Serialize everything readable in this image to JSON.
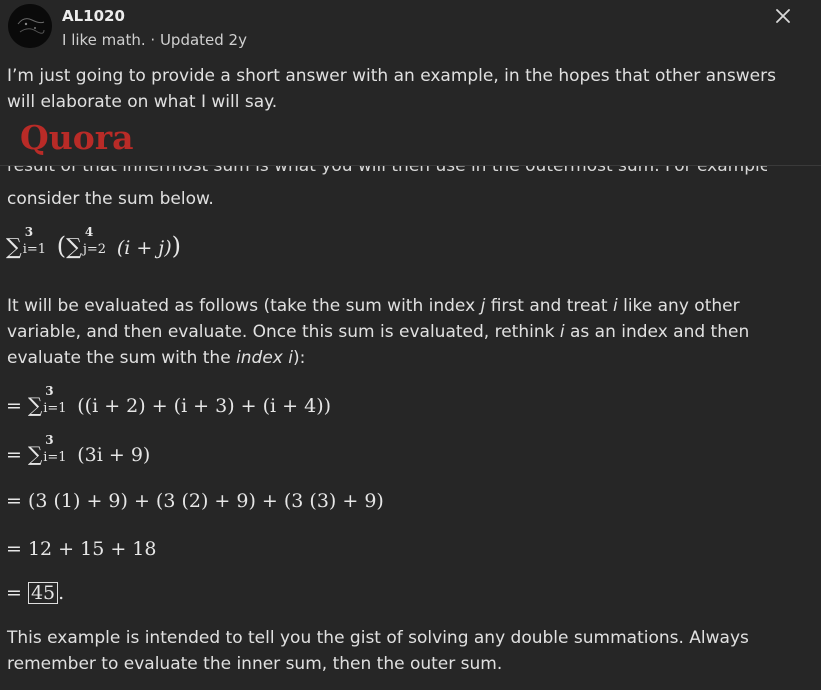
{
  "header": {
    "author": "AL1020",
    "meta": "I like math. · Updated 2y",
    "close_icon": "close-icon"
  },
  "intro": "I’m just going to provide a short answer with an example, in the hopes that other answers will elaborate on what I will say.",
  "banner": {
    "logo": "Quora"
  },
  "clipped_line": "result of that innermost sum is what you will then use in the outermost sum. For example,",
  "consider": "consider the sum below.",
  "main_expr": {
    "outer_upper": "3",
    "outer_lower": "i=1",
    "inner_upper": "4",
    "inner_lower": "j=2",
    "body": "(i + j)"
  },
  "explanation": {
    "part1": "It will be evaluated as follows (take the sum with index ",
    "var_j": "j",
    "part2": " first and treat ",
    "var_i1": "i",
    "part3": " like any other variable, and then evaluate. Once this sum is evaluated, rethink ",
    "var_i2": "i",
    "part4": " as an index and then evaluate the sum with the ",
    "index_word": "index",
    "space": " ",
    "var_i3": "i",
    "part5": "):"
  },
  "steps": {
    "s1": {
      "eq": "=",
      "upper": "3",
      "lower": "i=1",
      "body": "((i + 2) + (i + 3) + (i + 4))"
    },
    "s2": {
      "eq": "=",
      "upper": "3",
      "lower": "i=1",
      "body": "(3i + 9)"
    },
    "s3": "= (3 (1) + 9) + (3 (2) + 9) + (3 (3) + 9)",
    "s4": "= 12 + 15 + 18",
    "s5": {
      "eq": "=",
      "boxed": "45",
      "tail": "."
    }
  },
  "conclusion": "This example is intended to tell you the gist of solving any double summations. Always remember to evaluate the inner sum, then the outer sum.",
  "colors": {
    "brand": "#b92b27",
    "background": "#262626",
    "text": "#e0e0e0"
  }
}
